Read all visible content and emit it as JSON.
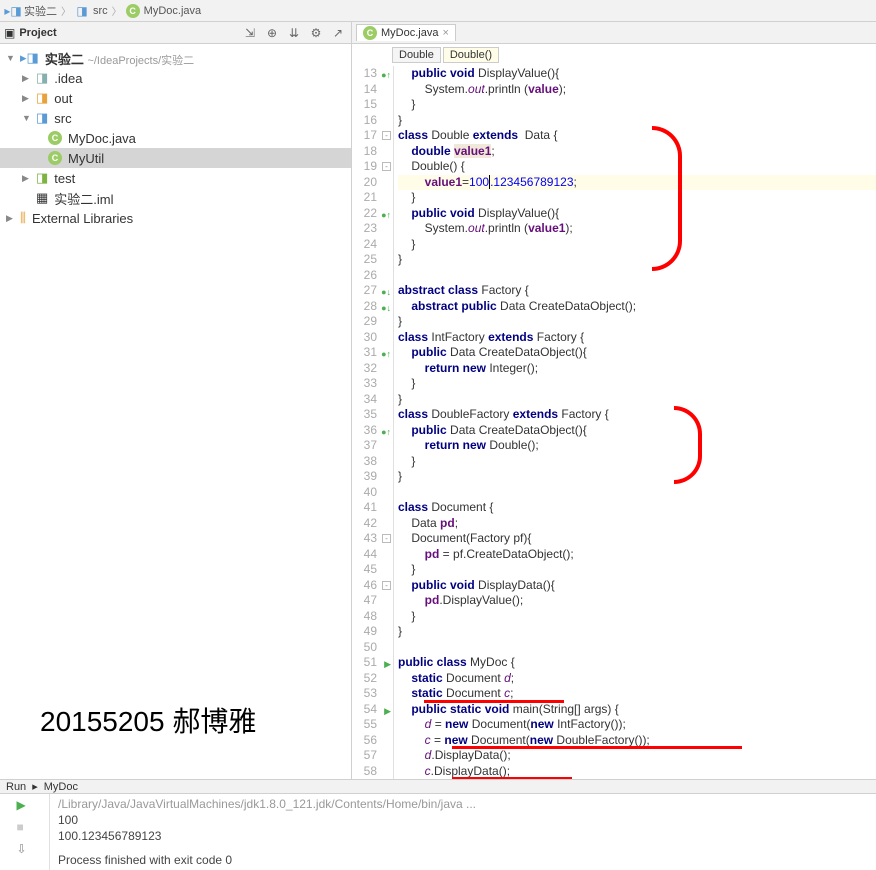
{
  "breadcrumb": {
    "root": "实验二",
    "src": "src",
    "file": "MyDoc.java"
  },
  "project": {
    "title": "Project",
    "root": "实验二",
    "rootPath": "~/IdeaProjects/实验二",
    "idea": ".idea",
    "out": "out",
    "src": "src",
    "mydoc": "MyDoc.java",
    "myutil": "MyUtil",
    "test": "test",
    "iml": "实验二.iml",
    "extlib": "External Libraries"
  },
  "tab": {
    "name": "MyDoc.java"
  },
  "crumbs": {
    "c1": "Double",
    "c2": "Double()"
  },
  "code": {
    "l13": "    public void DisplayValue(){",
    "l14": "        System.out.println (value);",
    "l15": "    }",
    "l16": "}",
    "l17": "class Double extends  Data {",
    "l18": "    double value1;",
    "l19": "    Double() {",
    "l20": "        value1=100.123456789123;",
    "l21": "    }",
    "l22": "    public void DisplayValue(){",
    "l23": "        System.out.println (value1);",
    "l24": "    }",
    "l25": "}",
    "l26": "",
    "l27": "abstract class Factory {",
    "l28": "    abstract public Data CreateDataObject();",
    "l29": "}",
    "l30": "class IntFactory extends Factory {",
    "l31": "    public Data CreateDataObject(){",
    "l32": "        return new Integer();",
    "l33": "    }",
    "l34": "}",
    "l35": "class DoubleFactory extends Factory {",
    "l36": "    public Data CreateDataObject(){",
    "l37": "        return new Double();",
    "l38": "    }",
    "l39": "}",
    "l40": "",
    "l41": "class Document {",
    "l42": "    Data pd;",
    "l43": "    Document(Factory pf){",
    "l44": "        pd = pf.CreateDataObject();",
    "l45": "    }",
    "l46": "    public void DisplayData(){",
    "l47": "        pd.DisplayValue();",
    "l48": "    }",
    "l49": "}",
    "l50": "",
    "l51": "public class MyDoc {",
    "l52": "    static Document d;",
    "l53": "    static Document c;",
    "l54": "    public static void main(String[] args) {",
    "l55": "        d = new Document(new IntFactory());",
    "l56": "        c = new Document(new DoubleFactory());",
    "l57": "        d.DisplayData();",
    "l58": "        c.DisplayData();"
  },
  "lineNums": [
    "13",
    "14",
    "15",
    "16",
    "17",
    "18",
    "19",
    "20",
    "21",
    "22",
    "23",
    "24",
    "25",
    "26",
    "27",
    "28",
    "29",
    "30",
    "31",
    "32",
    "33",
    "34",
    "35",
    "36",
    "37",
    "38",
    "39",
    "40",
    "41",
    "42",
    "43",
    "44",
    "45",
    "46",
    "47",
    "48",
    "49",
    "50",
    "51",
    "52",
    "53",
    "54",
    "55",
    "56",
    "57",
    "58"
  ],
  "watermark": "20155205 郝博雅",
  "run": {
    "label": "Run",
    "config": "MyDoc",
    "cmd": "/Library/Java/JavaVirtualMachines/jdk1.8.0_121.jdk/Contents/Home/bin/java ...",
    "out1": "100",
    "out2": "100.123456789123",
    "exit": "Process finished with exit code 0"
  }
}
